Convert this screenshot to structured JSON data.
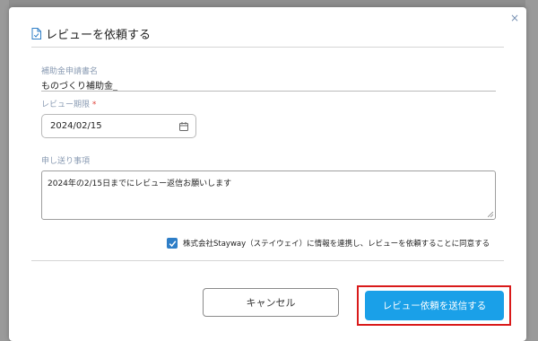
{
  "dialog": {
    "title": "レビューを依頼する",
    "close_label": "×"
  },
  "form": {
    "subsidy_label": "補助金申請書名",
    "subsidy_value": "ものづくり補助金_",
    "deadline_label": "レビュー期限",
    "deadline_required_mark": "*",
    "deadline_value": "2024/02/15",
    "notes_label": "申し送り事項",
    "notes_value": "2024年の2/15日までにレビュー返信お願いします",
    "consent_checked": true,
    "consent_text": "株式会社Stayway（ステイウェイ）に情報を連携し、レビューを依頼することに同意する"
  },
  "buttons": {
    "cancel": "キャンセル",
    "submit": "レビュー依頼を送信する"
  },
  "colors": {
    "submit_bg": "#1aa0e8",
    "checkbox": "#2e7ec7",
    "highlight": "#d91a1a",
    "required": "#e0443a"
  }
}
